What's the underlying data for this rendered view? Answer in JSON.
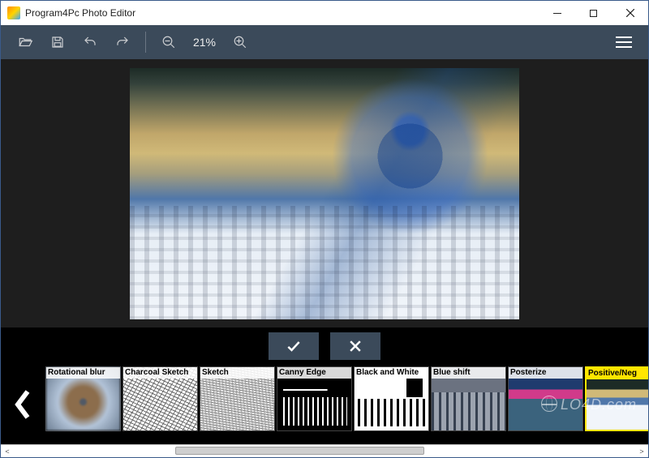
{
  "window": {
    "title": "Program4Pc Photo Editor"
  },
  "toolbar": {
    "zoom_value": "21%"
  },
  "confirm": {
    "accept": "accept",
    "cancel": "cancel"
  },
  "effects": {
    "items": [
      {
        "label": "Rotational blur"
      },
      {
        "label": "Charcoal Sketch"
      },
      {
        "label": "Sketch"
      },
      {
        "label": "Canny Edge"
      },
      {
        "label": "Black and White"
      },
      {
        "label": "Blue shift"
      },
      {
        "label": "Posterize"
      },
      {
        "label": "Positive/Neg"
      }
    ],
    "selected_index": 7
  },
  "watermark": "LO4D.com"
}
